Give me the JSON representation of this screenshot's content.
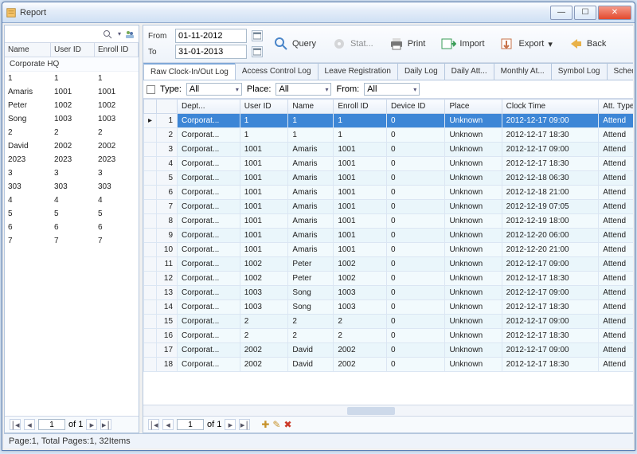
{
  "window": {
    "title": "Report"
  },
  "winbuttons": {
    "min": "—",
    "max": "☐",
    "close": "✕"
  },
  "date": {
    "from_label": "From",
    "to_label": "To",
    "from": "01-11-2012",
    "to": "31-01-2013"
  },
  "toolbar": {
    "query": "Query",
    "stat": "Stat...",
    "print": "Print",
    "import": "Import",
    "export": "Export",
    "back": "Back"
  },
  "tree": {
    "cols": [
      "Name",
      "User ID",
      "Enroll ID"
    ],
    "group": "Corporate HQ",
    "rows": [
      [
        "1",
        "1",
        "1"
      ],
      [
        "Amaris",
        "1001",
        "1001"
      ],
      [
        "Peter",
        "1002",
        "1002"
      ],
      [
        "Song",
        "1003",
        "1003"
      ],
      [
        "2",
        "2",
        "2"
      ],
      [
        "David",
        "2002",
        "2002"
      ],
      [
        "2023",
        "2023",
        "2023"
      ],
      [
        "3",
        "3",
        "3"
      ],
      [
        "303",
        "303",
        "303"
      ],
      [
        "4",
        "4",
        "4"
      ],
      [
        "5",
        "5",
        "5"
      ],
      [
        "6",
        "6",
        "6"
      ],
      [
        "7",
        "7",
        "7"
      ]
    ]
  },
  "tabs": [
    "Raw Clock-In/Out Log",
    "Access Control Log",
    "Leave Registration",
    "Daily Log",
    "Daily Att...",
    "Monthly At...",
    "Symbol Log",
    "Schedule"
  ],
  "filter": {
    "type_label": "Type:",
    "type_value": "All",
    "place_label": "Place:",
    "place_value": "All",
    "from_label": "From:",
    "from_value": "All"
  },
  "grid": {
    "cols": [
      "Dept...",
      "User ID",
      "Name",
      "Enroll ID",
      "Device ID",
      "Place",
      "Clock Time",
      "Att. Type"
    ],
    "rows": [
      [
        "Corporat...",
        "1",
        "1",
        "1",
        "0",
        "Unknown",
        "2012-12-17 09:00",
        "Attend"
      ],
      [
        "Corporat...",
        "1",
        "1",
        "1",
        "0",
        "Unknown",
        "2012-12-17 18:30",
        "Attend"
      ],
      [
        "Corporat...",
        "1001",
        "Amaris",
        "1001",
        "0",
        "Unknown",
        "2012-12-17 09:00",
        "Attend"
      ],
      [
        "Corporat...",
        "1001",
        "Amaris",
        "1001",
        "0",
        "Unknown",
        "2012-12-17 18:30",
        "Attend"
      ],
      [
        "Corporat...",
        "1001",
        "Amaris",
        "1001",
        "0",
        "Unknown",
        "2012-12-18 06:30",
        "Attend"
      ],
      [
        "Corporat...",
        "1001",
        "Amaris",
        "1001",
        "0",
        "Unknown",
        "2012-12-18 21:00",
        "Attend"
      ],
      [
        "Corporat...",
        "1001",
        "Amaris",
        "1001",
        "0",
        "Unknown",
        "2012-12-19 07:05",
        "Attend"
      ],
      [
        "Corporat...",
        "1001",
        "Amaris",
        "1001",
        "0",
        "Unknown",
        "2012-12-19 18:00",
        "Attend"
      ],
      [
        "Corporat...",
        "1001",
        "Amaris",
        "1001",
        "0",
        "Unknown",
        "2012-12-20 06:00",
        "Attend"
      ],
      [
        "Corporat...",
        "1001",
        "Amaris",
        "1001",
        "0",
        "Unknown",
        "2012-12-20 21:00",
        "Attend"
      ],
      [
        "Corporat...",
        "1002",
        "Peter",
        "1002",
        "0",
        "Unknown",
        "2012-12-17 09:00",
        "Attend"
      ],
      [
        "Corporat...",
        "1002",
        "Peter",
        "1002",
        "0",
        "Unknown",
        "2012-12-17 18:30",
        "Attend"
      ],
      [
        "Corporat...",
        "1003",
        "Song",
        "1003",
        "0",
        "Unknown",
        "2012-12-17 09:00",
        "Attend"
      ],
      [
        "Corporat...",
        "1003",
        "Song",
        "1003",
        "0",
        "Unknown",
        "2012-12-17 18:30",
        "Attend"
      ],
      [
        "Corporat...",
        "2",
        "2",
        "2",
        "0",
        "Unknown",
        "2012-12-17 09:00",
        "Attend"
      ],
      [
        "Corporat...",
        "2",
        "2",
        "2",
        "0",
        "Unknown",
        "2012-12-17 18:30",
        "Attend"
      ],
      [
        "Corporat...",
        "2002",
        "David",
        "2002",
        "0",
        "Unknown",
        "2012-12-17 09:00",
        "Attend"
      ],
      [
        "Corporat...",
        "2002",
        "David",
        "2002",
        "0",
        "Unknown",
        "2012-12-17 18:30",
        "Attend"
      ]
    ],
    "selected": 0
  },
  "pager": {
    "page": "1",
    "of_label": "of 1",
    "left_of": "of 1"
  },
  "status": "Page:1, Total Pages:1, 32Items"
}
